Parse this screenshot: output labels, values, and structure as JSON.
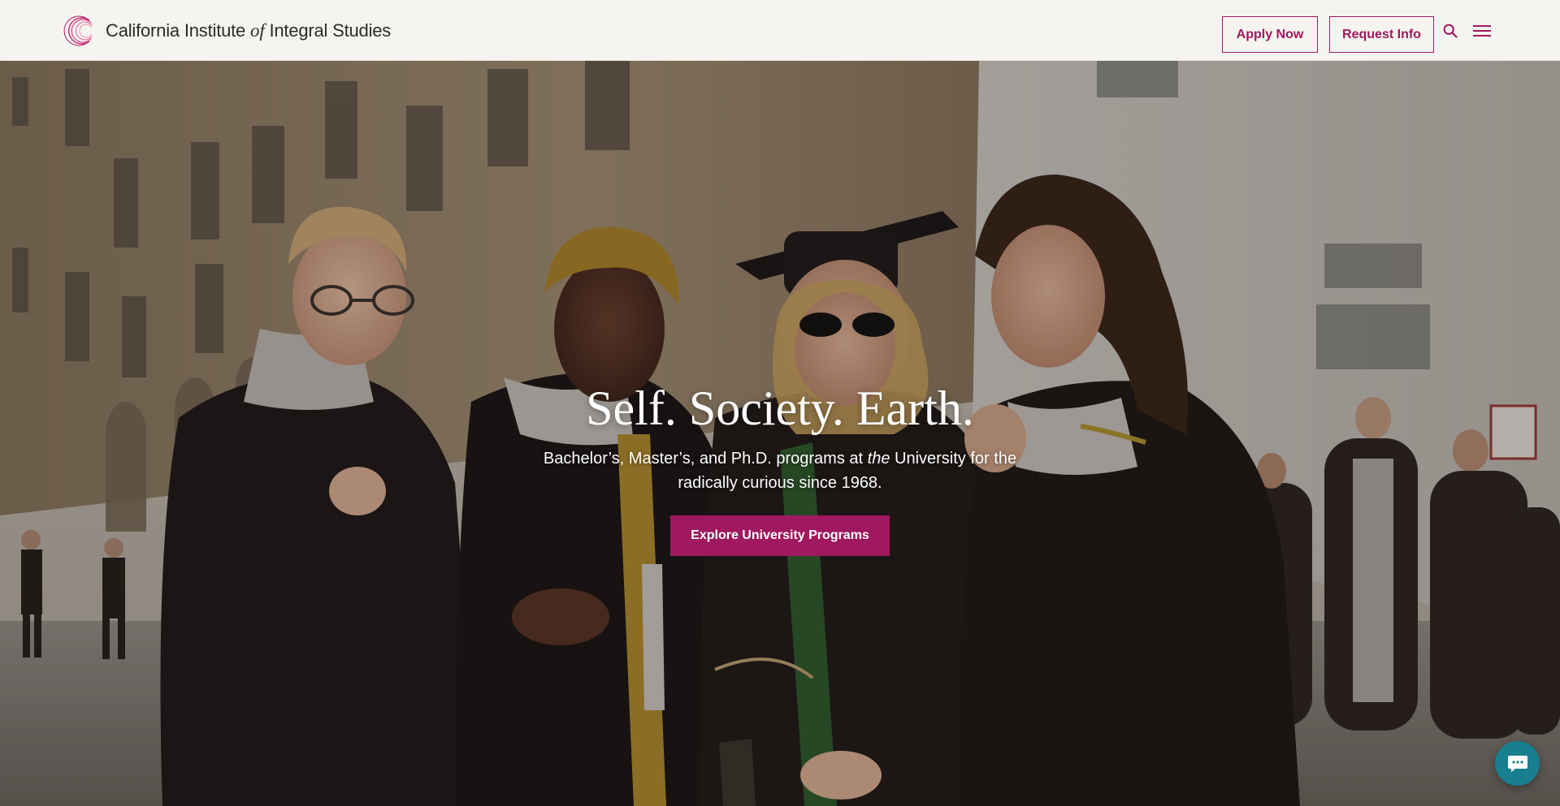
{
  "header": {
    "logo_name_before": "California Institute",
    "logo_name_italic": "of",
    "logo_name_after": "Integral Studies",
    "apply_label": "Apply Now",
    "request_label": "Request Info",
    "search_icon": "search-icon",
    "menu_icon": "hamburger-menu-icon"
  },
  "hero": {
    "title": "Self. Society. Earth.",
    "subtitle_before": "Bachelor’s, Master’s, and Ph.D. programs at",
    "subtitle_italic": "the",
    "subtitle_after": "University for the radically curious since 1968.",
    "cta_label": "Explore University Programs"
  },
  "chat": {
    "icon": "chat-bubble-icon"
  },
  "colors": {
    "brand_magenta": "#a0185f",
    "header_bg": "#f6f4f0",
    "chat_teal": "#187f8e"
  }
}
